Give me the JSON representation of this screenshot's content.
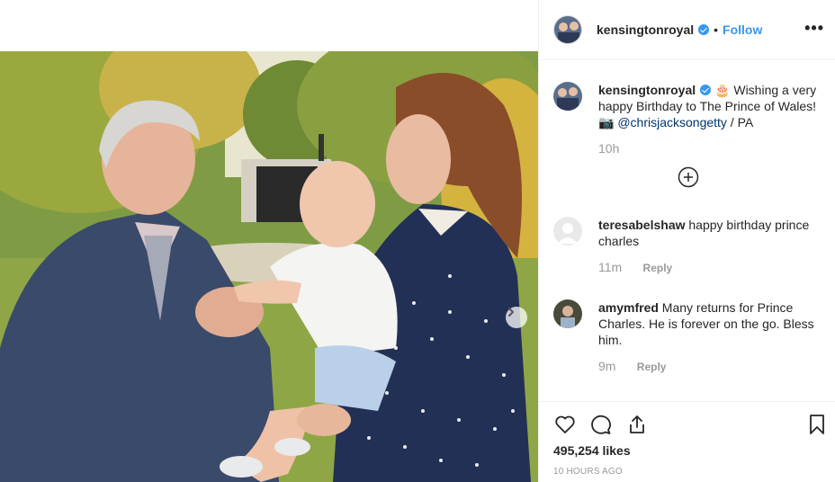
{
  "post": {
    "username": "kensingtonroyal",
    "follow_label": "Follow",
    "dot": "•",
    "more_label": "•••",
    "caption": {
      "username": "kensingtonroyal",
      "text_before": " 🎂 Wishing a very happy Birthday to The Prince of Wales! 📷 ",
      "mention": "@chrisjacksongetty",
      "text_after": " / PA",
      "age": "10h"
    },
    "comments": [
      {
        "username": "teresabelshaw",
        "text": " happy birthday prince charles",
        "age": "11m",
        "reply_label": "Reply"
      },
      {
        "username": "amymfred",
        "text": " Many returns for Prince Charles. He is forever on the go. Bless him.",
        "age": "9m",
        "reply_label": "Reply"
      }
    ],
    "likes": "495,254 likes",
    "timestamp": "10 HOURS AGO"
  },
  "icons": {
    "verified": "verified-badge-icon",
    "load_more": "plus-circle-icon",
    "like": "heart-icon",
    "comment": "comment-bubble-icon",
    "share": "share-icon",
    "save": "bookmark-icon",
    "next": "chevron-right-icon"
  },
  "colors": {
    "accent": "#3897f0",
    "muted": "#999999",
    "text": "#262626",
    "border": "#efefef"
  }
}
